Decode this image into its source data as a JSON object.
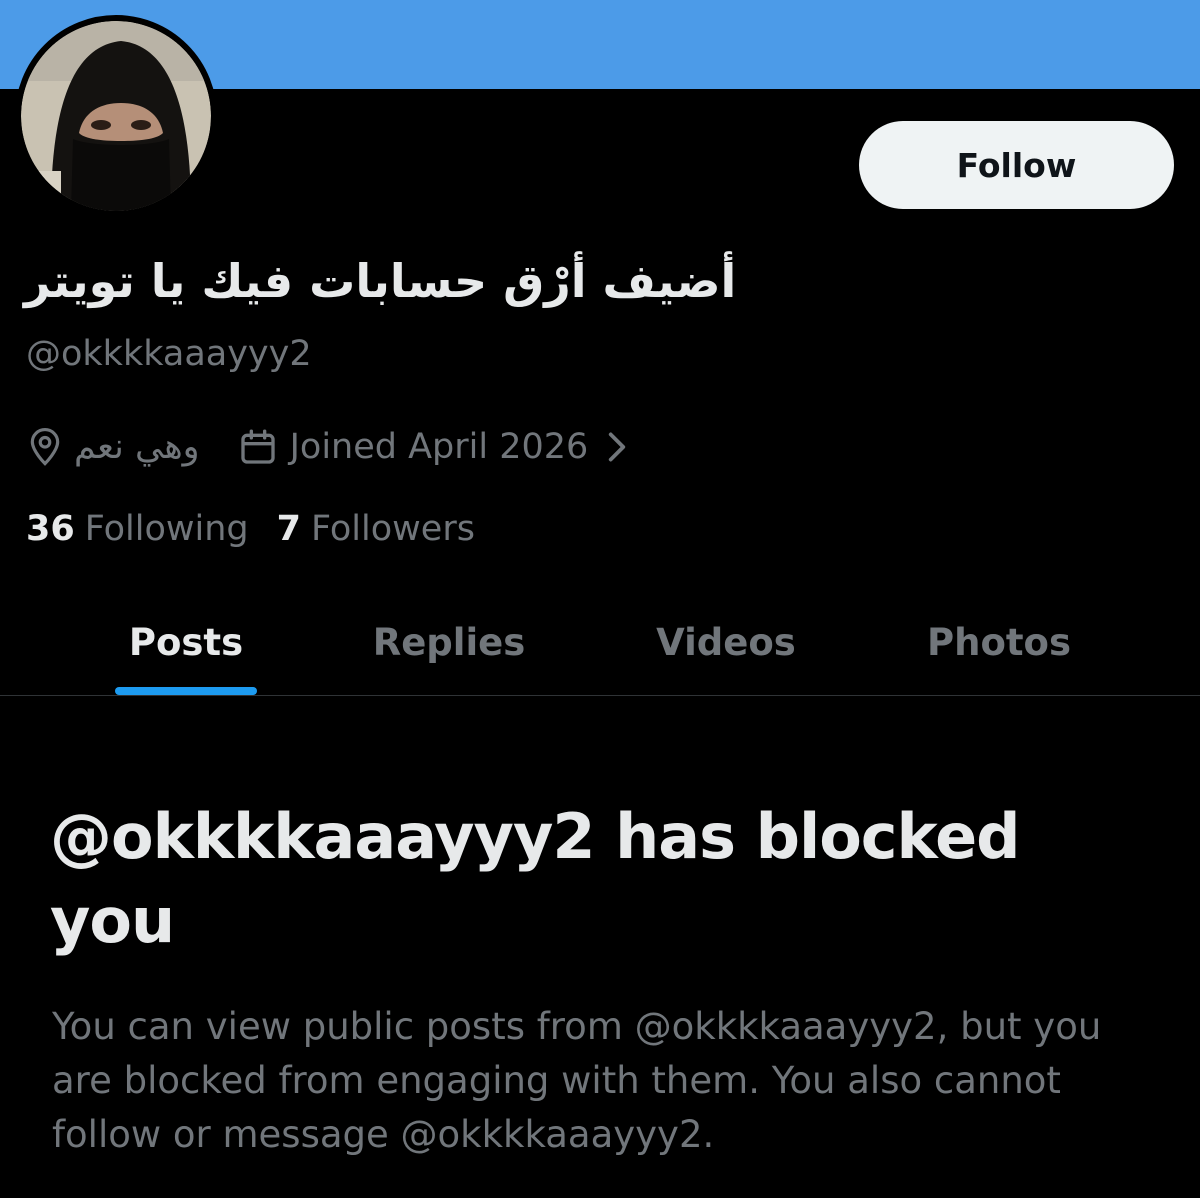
{
  "colors": {
    "banner": "#4c9be8",
    "accent": "#1d9bf0",
    "background": "#000000",
    "primary_text": "#e7e9ea",
    "secondary_text": "#71767b",
    "follow_button_bg": "#eff3f4"
  },
  "profile": {
    "display_name": "أضيف أرْق حسابات فيك يا تويتر",
    "handle": "@okkkkaaayyy2",
    "location": "وهي نعم",
    "joined": "Joined April 2026",
    "following_count": "36",
    "following_label": "Following",
    "followers_count": "7",
    "followers_label": "Followers"
  },
  "actions": {
    "follow_label": "Follow"
  },
  "icons": {
    "location": "location-pin-icon",
    "calendar": "calendar-icon",
    "chevron": "chevron-right-icon"
  },
  "tabs": [
    {
      "label": "Posts",
      "active": true
    },
    {
      "label": "Replies",
      "active": false
    },
    {
      "label": "Videos",
      "active": false
    },
    {
      "label": "Photos",
      "active": false
    }
  ],
  "blocked": {
    "title": "@okkkkaaayyy2 has blocked you",
    "body": "You can view public posts from @okkkkaaayyy2, but you are blocked from engaging with them. You also cannot follow or message @okkkkaaayyy2."
  }
}
